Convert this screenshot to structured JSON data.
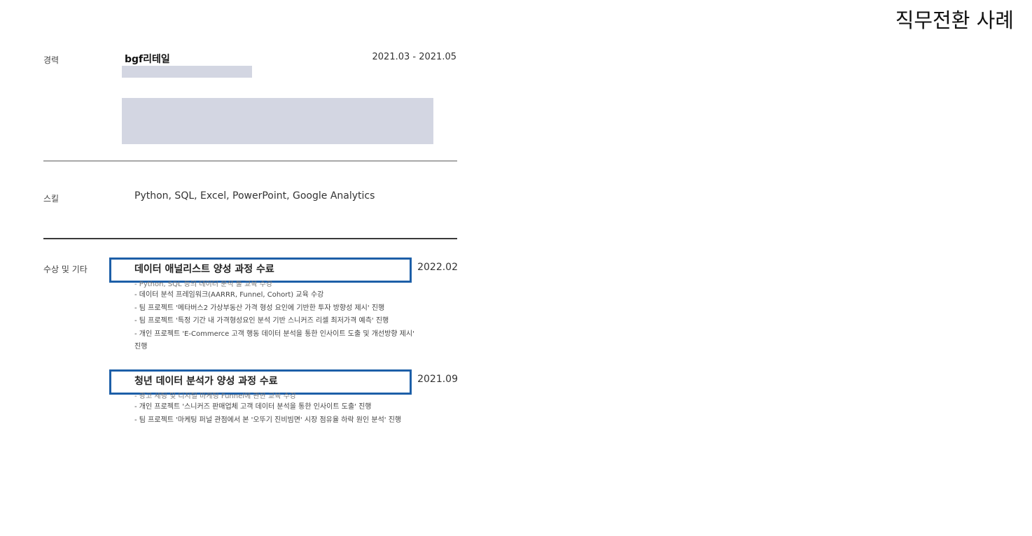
{
  "page": {
    "heading": "직무전환 사례"
  },
  "resume": {
    "career": {
      "label": "경력",
      "company": "bgf리테일",
      "period": "2021.03 - 2021.05"
    },
    "skills": {
      "label": "스킬",
      "value": "Python, SQL, Excel, PowerPoint, Google Analytics"
    },
    "awards": {
      "label": "수상 및 기타",
      "items": [
        {
          "title": "데이터 애널리스트 양성 과정 수료",
          "date": "2022.02",
          "bullets": [
            "- Python, SQL 등의 데이터 분석 툴 교육 수강",
            "- 데이터 분석 프레임워크(AARRR, Funnel, Cohort) 교육 수강",
            "- 팀 프로젝트 '메타버스2 가상부동산 가격 형성 요인에 기반한 투자 방향성 제시' 진행",
            "- 팀 프로젝트 '특정 기간 내 가격형성요인 분석 기반 스니커즈 리셀 최저가격 예측' 진행",
            "- 개인 프로젝트 'E-Commerce 고객 행동 데이터 분석을 통한 인사이트 도출 및 개선방향 제시'",
            "진행"
          ]
        },
        {
          "title": "청년 데이터 분석가 양성 과정 수료",
          "date": "2021.09",
          "bullets": [
            "- 광고 세팅 및 디지털 마케팅 Funnel에 관한 교육 수강",
            "- 개인 프로젝트 '스니커즈 판매업체 고객 데이터 분석을 통한 인사이트 도출' 진행",
            "- 팀 프로젝트 '마케팅 퍼널 관점에서 본 '오뚜기 진비빔면' 시장 점유율 하락 원인 분석' 진행"
          ]
        }
      ]
    }
  },
  "colors": {
    "highlight_border": "#1d5fa8",
    "redaction_fill": "#d3d6e2",
    "rule_light": "#a8a8a8",
    "rule_dark": "#3a3a3a"
  }
}
